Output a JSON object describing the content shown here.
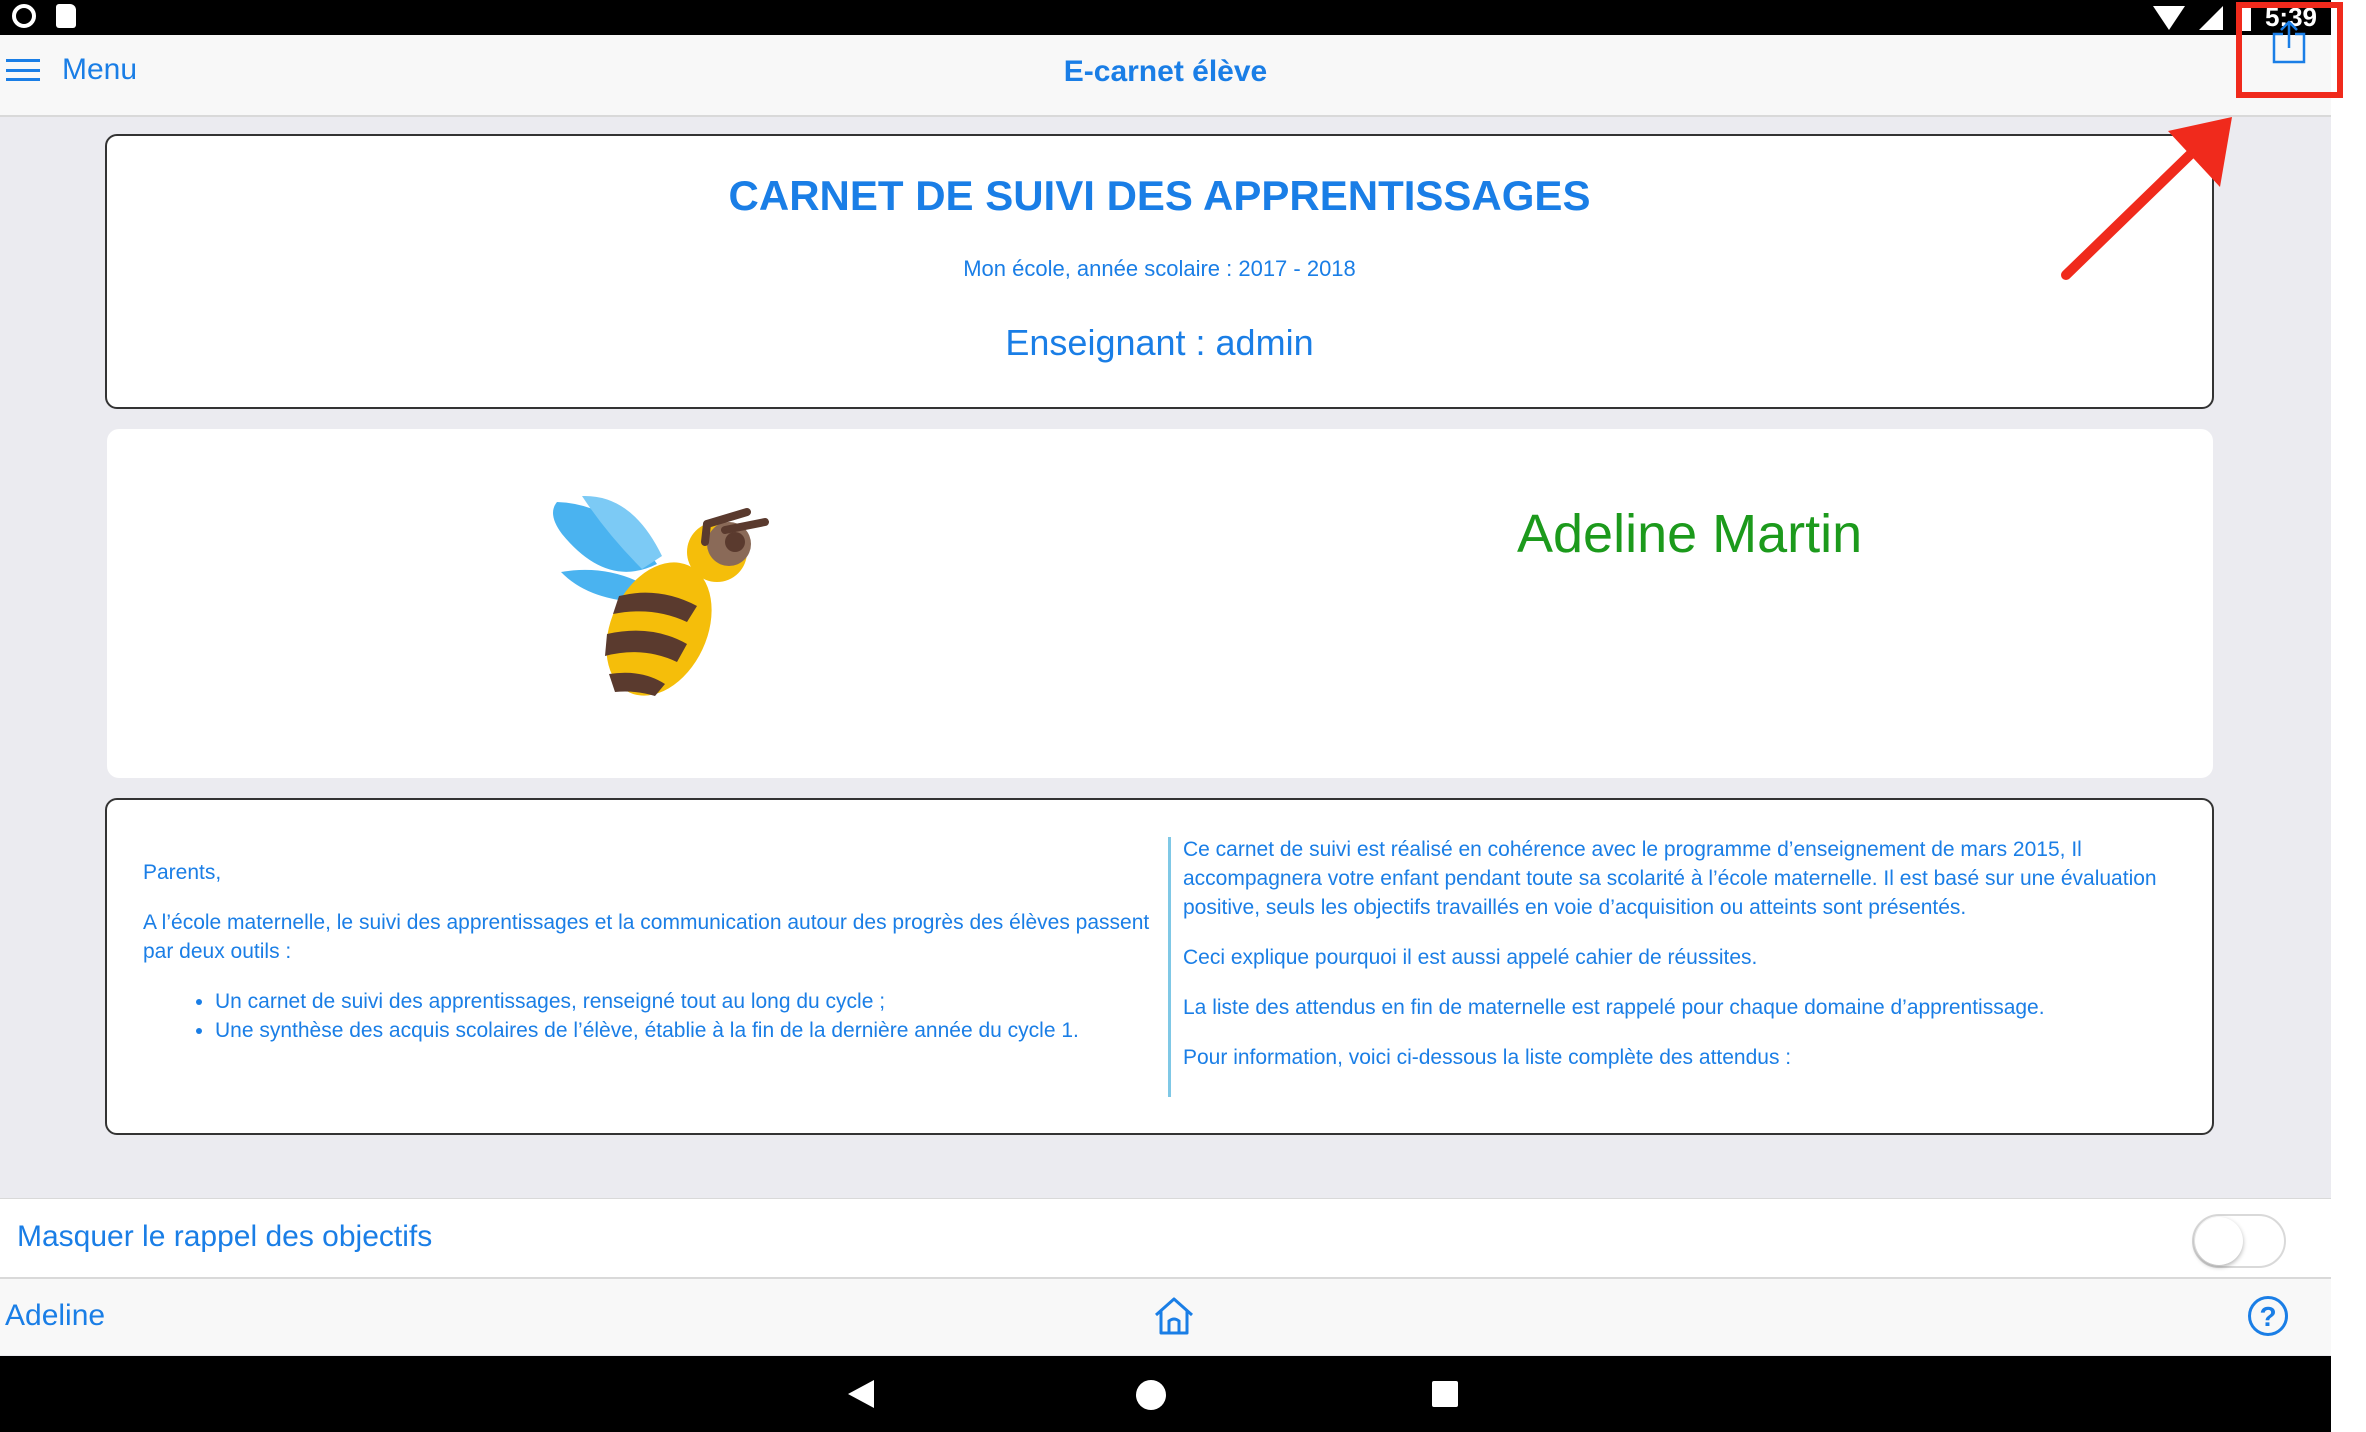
{
  "status_bar": {
    "time": "5:39"
  },
  "nav": {
    "menu_label": "Menu",
    "title": "E-carnet élève"
  },
  "header_card": {
    "title": "CARNET DE SUIVI DES APPRENTISSAGES",
    "subtitle": "Mon école, année scolaire : 2017 - 2018",
    "teacher": "Enseignant : admin"
  },
  "student_card": {
    "name": "Adeline Martin"
  },
  "info_card": {
    "left": {
      "greeting": "Parents,",
      "intro": "A l’école maternelle, le suivi des apprentissages et la communication autour des progrès des élèves passent par deux outils :",
      "items": [
        "Un carnet de suivi des apprentissages, renseigné tout au long du cycle ;",
        "Une synthèse des acquis scolaires de l’élève, établie à la fin de la dernière année du cycle 1."
      ]
    },
    "right": {
      "p1": "Ce carnet de suivi est réalisé en cohérence avec le programme d’enseignement de mars 2015, Il accompagnera votre enfant pendant toute sa scolarité à l’école maternelle. Il est basé sur une évaluation positive, seuls les objectifs travaillés en voie d’acquisition ou atteints sont présentés.",
      "p2": "Ceci explique pourquoi il est aussi appelé cahier de réussites.",
      "p3": "La liste des attendus en fin de maternelle est rappelé pour chaque domaine d’apprentissage.",
      "p4": "Pour information, voici ci-dessous la liste complète des attendus :"
    }
  },
  "toggle": {
    "label": "Masquer le rappel des objectifs",
    "on": false
  },
  "bottom_bar": {
    "student_tab": "Adeline",
    "help_label": "?"
  },
  "icons": [
    "hamburger-icon",
    "share-icon",
    "bee-logo",
    "home-icon",
    "help-icon",
    "wifi-icon",
    "signal-icon",
    "battery-icon"
  ],
  "colors": {
    "accent": "#1a7ee6",
    "student_name": "#1c9a1c",
    "highlight": "#f02a1c"
  }
}
